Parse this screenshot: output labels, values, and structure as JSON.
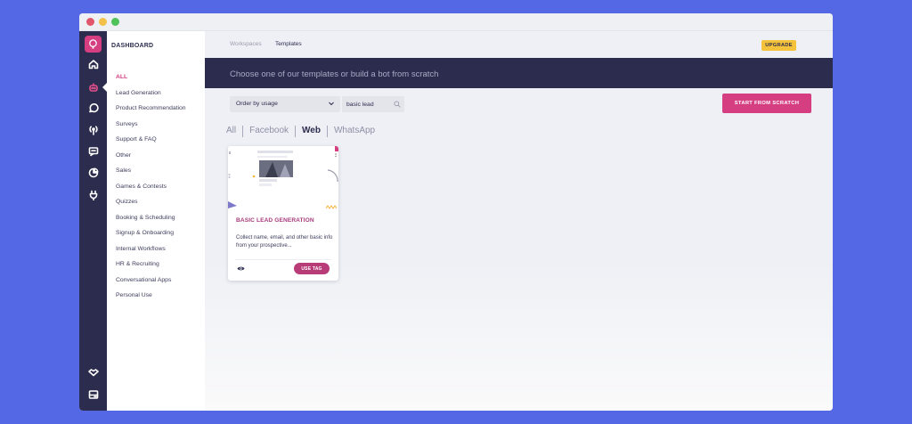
{
  "window": {
    "buttons": [
      {
        "color": "#e0566a"
      },
      {
        "color": "#f3c14a"
      },
      {
        "color": "#4fc35a"
      }
    ]
  },
  "sidebar": {
    "heading": "DASHBOARD",
    "categories": [
      {
        "label": "ALL",
        "active": true
      },
      {
        "label": "Lead Generation"
      },
      {
        "label": "Product Recommendation"
      },
      {
        "label": "Surveys"
      },
      {
        "label": "Support & FAQ"
      },
      {
        "label": "Other"
      },
      {
        "label": "Sales"
      },
      {
        "label": "Games & Contests"
      },
      {
        "label": "Quizzes"
      },
      {
        "label": "Booking & Scheduling"
      },
      {
        "label": "Signup & Onboarding"
      },
      {
        "label": "Internal Workflows"
      },
      {
        "label": "HR & Recruiting"
      },
      {
        "label": "Conversational Apps"
      },
      {
        "label": "Personal Use"
      }
    ]
  },
  "rail": {
    "icons": [
      "home-icon",
      "bot-icon",
      "whatsapp-icon",
      "broadcast-icon",
      "chat-icon",
      "analytics-icon",
      "integrations-icon",
      "partner-icon",
      "settings-panel-icon"
    ],
    "active": "bot-icon"
  },
  "topnav": {
    "tabs": [
      {
        "label": "Workspaces"
      },
      {
        "label": "Templates",
        "active": true
      }
    ],
    "upgrade": "UPGRADE"
  },
  "banner": {
    "text": "Choose one of our templates or build a bot from scratch"
  },
  "toolbar": {
    "order_value": "Order by usage",
    "search_value": "basic lead",
    "start_label": "START FROM SCRATCH"
  },
  "filters": [
    {
      "label": "All"
    },
    {
      "label": "Facebook"
    },
    {
      "label": "Web",
      "active": true
    },
    {
      "label": "WhatsApp"
    }
  ],
  "template_card": {
    "title": "BASIC LEAD GENERATION",
    "description": "Collect name, email, and other basic info from your prospective...",
    "use_label": "USE TAG"
  },
  "colors": {
    "brand": "#d63e82",
    "navy": "#2c2c4e",
    "background": "#5468e6",
    "upgrade": "#f5c33b"
  }
}
